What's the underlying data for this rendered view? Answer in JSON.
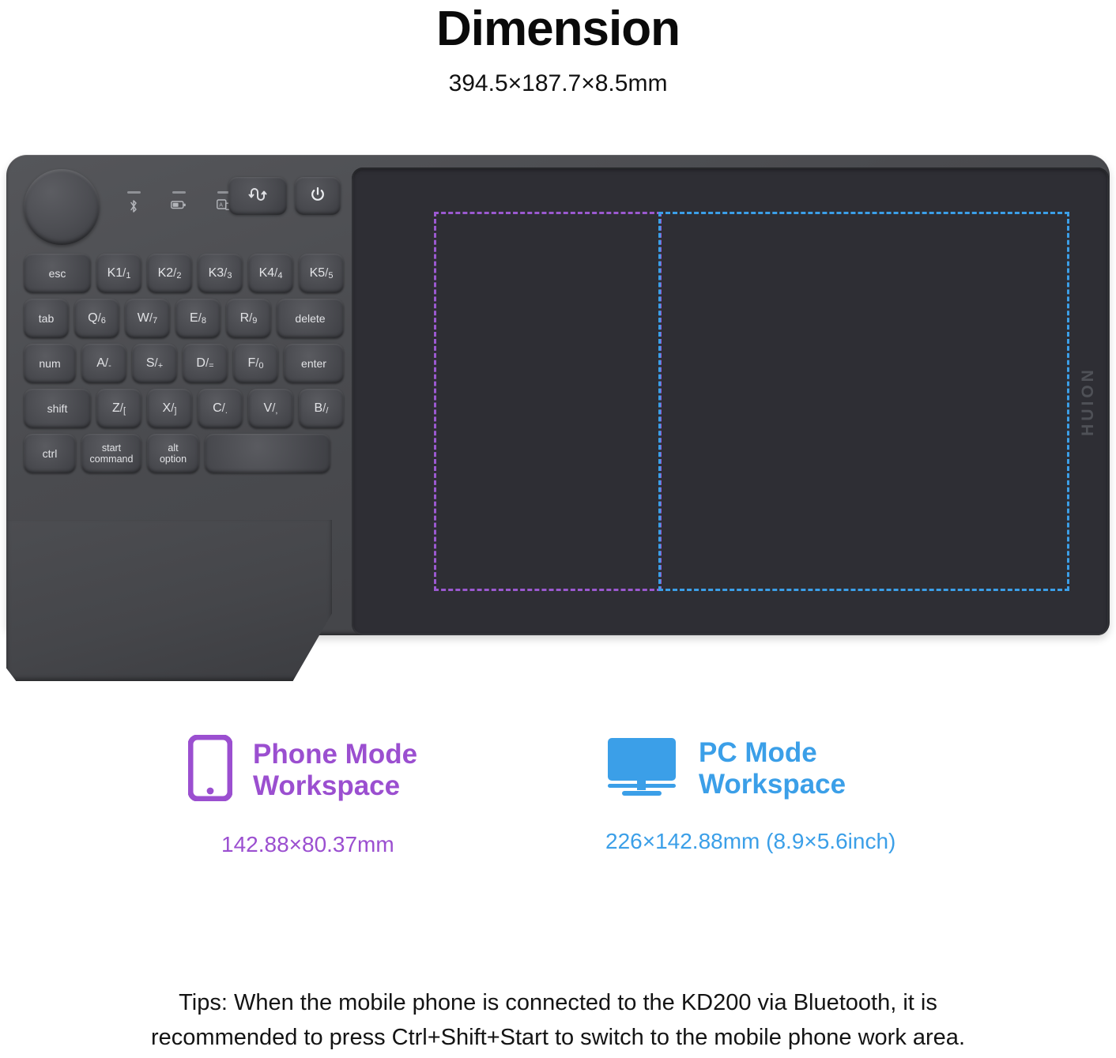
{
  "header": {
    "title": "Dimension",
    "subtitle": "394.5×187.7×8.5mm"
  },
  "device": {
    "brand_logo": "HUION",
    "dial": {
      "name": "rotary-dial"
    },
    "indicators": [
      {
        "icon": "bluetooth-icon",
        "label": "Bluetooth"
      },
      {
        "icon": "battery-icon",
        "label": "Battery"
      },
      {
        "icon": "screen-switch-icon",
        "label": "Screen Switch"
      }
    ],
    "buttons": [
      {
        "icon": "switch-mode-icon",
        "label": "Switch"
      },
      {
        "icon": "power-icon",
        "label": "Power"
      }
    ],
    "keyboard": {
      "rows": [
        [
          {
            "primary": "esc",
            "secondary": "",
            "style": "k-esc word"
          },
          {
            "primary": "K1",
            "secondary": "1",
            "style": "k-1u"
          },
          {
            "primary": "K2",
            "secondary": "2",
            "style": "k-1u"
          },
          {
            "primary": "K3",
            "secondary": "3",
            "style": "k-1u"
          },
          {
            "primary": "K4",
            "secondary": "4",
            "style": "k-1u"
          },
          {
            "primary": "K5",
            "secondary": "5",
            "style": "k-1u"
          }
        ],
        [
          {
            "primary": "tab",
            "secondary": "",
            "style": "k-tab word"
          },
          {
            "primary": "Q",
            "secondary": "6",
            "style": "k-1u"
          },
          {
            "primary": "W",
            "secondary": "7",
            "style": "k-1u"
          },
          {
            "primary": "E",
            "secondary": "8",
            "style": "k-1u"
          },
          {
            "primary": "R",
            "secondary": "9",
            "style": "k-1u"
          },
          {
            "primary": "delete",
            "secondary": "",
            "style": "k-delete word"
          }
        ],
        [
          {
            "primary": "num",
            "secondary": "",
            "style": "k-num word"
          },
          {
            "primary": "A",
            "secondary": "-",
            "style": "k-1u"
          },
          {
            "primary": "S",
            "secondary": "+",
            "style": "k-1u"
          },
          {
            "primary": "D",
            "secondary": "=",
            "style": "k-1u"
          },
          {
            "primary": "F",
            "secondary": "0",
            "style": "k-1u"
          },
          {
            "primary": "enter",
            "secondary": "",
            "style": "k-enter word"
          }
        ],
        [
          {
            "primary": "shift",
            "secondary": "",
            "style": "k-shift word"
          },
          {
            "primary": "Z",
            "secondary": "[",
            "style": "k-1u"
          },
          {
            "primary": "X",
            "secondary": "]",
            "style": "k-1u"
          },
          {
            "primary": "C",
            "secondary": ".",
            "style": "k-1u"
          },
          {
            "primary": "V",
            "secondary": ",",
            "style": "k-1u"
          },
          {
            "primary": "B",
            "secondary": "/",
            "style": "k-1u"
          }
        ],
        [
          {
            "primary": "ctrl",
            "secondary": "",
            "style": "k-ctrl word"
          },
          {
            "primary": "start",
            "primary2": "command",
            "secondary": "",
            "style": "k-start two-line"
          },
          {
            "primary": "alt",
            "primary2": "option",
            "secondary": "",
            "style": "k-alt two-line"
          },
          {
            "primary": "",
            "secondary": "",
            "style": "k-space"
          }
        ]
      ]
    },
    "work_areas": [
      {
        "name": "phone-work-area",
        "color": "#9b59d0"
      },
      {
        "name": "pc-work-area",
        "color": "#3b9fe8"
      }
    ]
  },
  "legends": [
    {
      "icon": "phone-icon",
      "title_line1": "Phone Mode",
      "title_line2": "Workspace",
      "measure": "142.88×80.37mm",
      "color": "#9b4fd0"
    },
    {
      "icon": "monitor-icon",
      "title_line1": "PC Mode",
      "title_line2": "Workspace",
      "measure": "226×142.88mm (8.9×5.6inch)",
      "color": "#3b9fe8"
    }
  ],
  "tips": {
    "line1": "Tips:  When the mobile phone is connected to the KD200 via Bluetooth, it is",
    "line2": "recommended to press Ctrl+Shift+Start to switch to the mobile phone work area."
  }
}
